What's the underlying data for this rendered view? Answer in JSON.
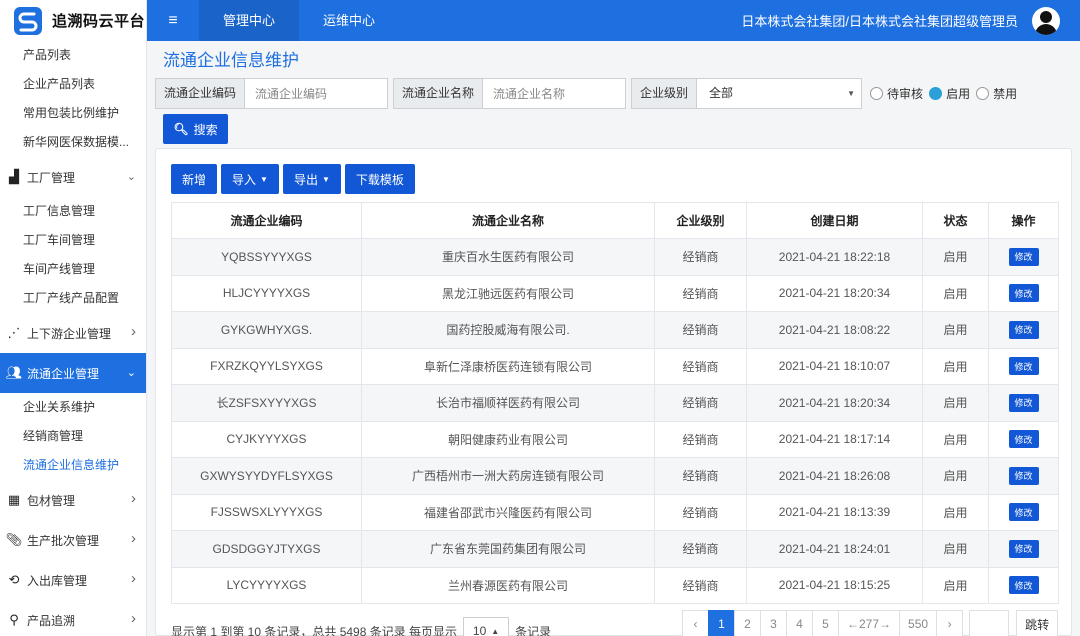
{
  "brand": {
    "name": "追溯码云平台",
    "accent": "#1e6fe0"
  },
  "topbar": {
    "tabs": [
      {
        "label": "管理中心",
        "active": true
      },
      {
        "label": "运维中心",
        "active": false
      }
    ],
    "user": "日本株式会社集团/日本株式会社集团超级管理员"
  },
  "sidebar": {
    "top_items": [
      "产品列表",
      "企业产品列表",
      "常用包装比例维护",
      "新华网医保数据模..."
    ],
    "groups": [
      {
        "label": "工厂管理",
        "icon": "factory-icon",
        "expanded": true,
        "children": [
          "工厂信息管理",
          "工厂车间管理",
          "车间产线管理",
          "工厂产线产品配置"
        ]
      },
      {
        "label": "上下游企业管理",
        "icon": "network-icon",
        "expanded": false,
        "children": []
      },
      {
        "label": "流通企业管理",
        "icon": "users-icon",
        "expanded": true,
        "active": true,
        "children": [
          "企业关系维护",
          "经销商管理",
          "流通企业信息维护"
        ]
      },
      {
        "label": "包材管理",
        "icon": "qrcode-icon",
        "expanded": false,
        "children": []
      },
      {
        "label": "生产批次管理",
        "icon": "paperclip-icon",
        "expanded": false,
        "children": []
      },
      {
        "label": "入出库管理",
        "icon": "sync-icon",
        "expanded": false,
        "children": []
      },
      {
        "label": "产品追溯",
        "icon": "search-icon",
        "expanded": false,
        "children": []
      }
    ],
    "active_child": "流通企业信息维护"
  },
  "page": {
    "title": "流通企业信息维护"
  },
  "filter": {
    "code_label": "流通企业编码",
    "code_placeholder": "流通企业编码",
    "name_label": "流通企业名称",
    "name_placeholder": "流通企业名称",
    "level_label": "企业级别",
    "level_value": "全部",
    "status_options": [
      {
        "label": "待审核",
        "checked": false
      },
      {
        "label": "启用",
        "checked": true
      },
      {
        "label": "禁用",
        "checked": false
      }
    ],
    "search_label": "搜索"
  },
  "toolbar": {
    "add_label": "新增",
    "import_label": "导入",
    "export_label": "导出",
    "template_label": "下载模板"
  },
  "table": {
    "headers": [
      "流通企业编码",
      "流通企业名称",
      "企业级别",
      "创建日期",
      "状态",
      "操作"
    ],
    "edit_label": "修改",
    "rows": [
      {
        "code": "YQBSSYYYXGS",
        "name": "重庆百水生医药有限公司",
        "level": "经销商",
        "date": "2021-04-21 18:22:18",
        "status": "启用"
      },
      {
        "code": "HLJCYYYYXGS",
        "name": "黑龙江驰远医药有限公司",
        "level": "经销商",
        "date": "2021-04-21 18:20:34",
        "status": "启用"
      },
      {
        "code": "GYKGWHYXGS.",
        "name": "国药控股威海有限公司.",
        "level": "经销商",
        "date": "2021-04-21 18:08:22",
        "status": "启用"
      },
      {
        "code": "FXRZKQYYLSYXGS",
        "name": "阜新仁泽康桥医药连锁有限公司",
        "level": "经销商",
        "date": "2021-04-21 18:10:07",
        "status": "启用"
      },
      {
        "code": "长ZSFSXYYYXGS",
        "name": "长治市福顺祥医药有限公司",
        "level": "经销商",
        "date": "2021-04-21 18:20:34",
        "status": "启用"
      },
      {
        "code": "CYJKYYYXGS",
        "name": "朝阳健康药业有限公司",
        "level": "经销商",
        "date": "2021-04-21 18:17:14",
        "status": "启用"
      },
      {
        "code": "GXWYSYYDYFLSYXGS",
        "name": "广西梧州市一洲大药房连锁有限公司",
        "level": "经销商",
        "date": "2021-04-21 18:26:08",
        "status": "启用"
      },
      {
        "code": "FJSSWSXLYYYXGS",
        "name": "福建省邵武市兴隆医药有限公司",
        "level": "经销商",
        "date": "2021-04-21 18:13:39",
        "status": "启用"
      },
      {
        "code": "GDSDGGYJTYXGS",
        "name": "广东省东莞国药集团有限公司",
        "level": "经销商",
        "date": "2021-04-21 18:24:01",
        "status": "启用"
      },
      {
        "code": "LYCYYYYXGS",
        "name": "兰州春源医药有限公司",
        "level": "经销商",
        "date": "2021-04-21 18:15:25",
        "status": "启用"
      }
    ]
  },
  "pagination": {
    "summary": "显示第 1 到第 10 条记录，总共 5498 条记录 每页显示",
    "page_size": "10",
    "suffix": "条记录",
    "prev": "‹",
    "pages": [
      "1",
      "2",
      "3",
      "4",
      "5",
      "←277→",
      "550"
    ],
    "current": "1",
    "next": "›",
    "go_label": "跳转"
  }
}
